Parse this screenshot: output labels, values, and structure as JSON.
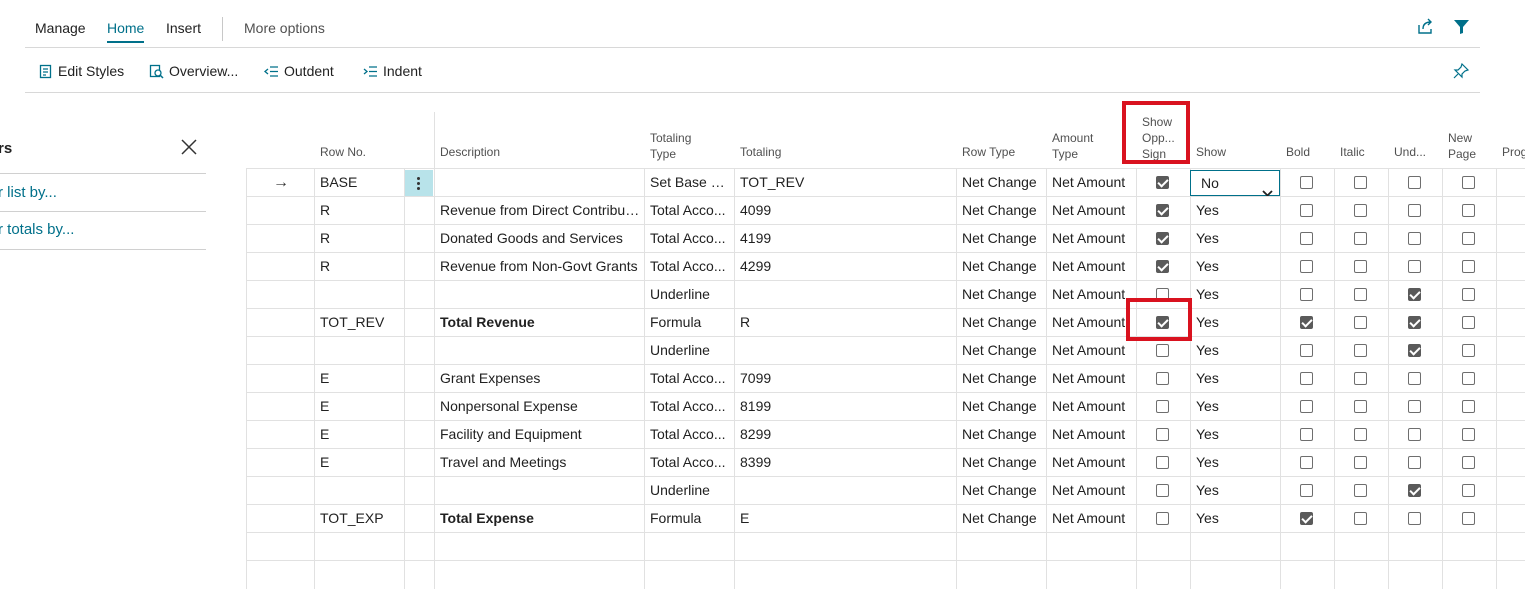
{
  "tabs": [
    {
      "label": "Manage"
    },
    {
      "label": "Home"
    },
    {
      "label": "Insert"
    },
    {
      "label": "More options"
    }
  ],
  "actions": {
    "edit_styles": "Edit Styles",
    "overview": "Overview...",
    "outdent": "Outdent",
    "indent": "Indent"
  },
  "left_pane": {
    "title": "rs",
    "link1": "r list by...",
    "link2": "r totals by..."
  },
  "columns": {
    "row_no": "Row No.",
    "description": "Description",
    "totaling_type_1": "Totaling",
    "totaling_type_2": "Type",
    "totaling": "Totaling",
    "row_type": "Row Type",
    "amount_type_1": "Amount",
    "amount_type_2": "Type",
    "show_opp_1": "Show",
    "show_opp_2": "Opp...",
    "show_opp_3": "Sign",
    "show": "Show",
    "bold": "Bold",
    "italic": "Italic",
    "underline": "Und...",
    "new_page_1": "New",
    "new_page_2": "Page",
    "prog": "Prog"
  },
  "show_select": {
    "value": "No"
  },
  "rows": [
    {
      "row_no": "BASE",
      "description": "",
      "desc_bold": false,
      "totaling_type": "Set Base Fo...",
      "totaling": "TOT_REV",
      "row_type": "Net Change",
      "amount_type": "Net Amount",
      "show_opp": true,
      "show": "No",
      "bold": false,
      "italic": false,
      "underline": false,
      "new_page": false
    },
    {
      "row_no": "R",
      "description": "Revenue from Direct Contribut...",
      "desc_bold": false,
      "totaling_type": "Total Acco...",
      "totaling": "4099",
      "row_type": "Net Change",
      "amount_type": "Net Amount",
      "show_opp": true,
      "show": "Yes",
      "bold": false,
      "italic": false,
      "underline": false,
      "new_page": false
    },
    {
      "row_no": "R",
      "description": "Donated Goods and Services",
      "desc_bold": false,
      "totaling_type": "Total Acco...",
      "totaling": "4199",
      "row_type": "Net Change",
      "amount_type": "Net Amount",
      "show_opp": true,
      "show": "Yes",
      "bold": false,
      "italic": false,
      "underline": false,
      "new_page": false
    },
    {
      "row_no": "R",
      "description": "Revenue from Non-Govt Grants",
      "desc_bold": false,
      "totaling_type": "Total Acco...",
      "totaling": "4299",
      "row_type": "Net Change",
      "amount_type": "Net Amount",
      "show_opp": true,
      "show": "Yes",
      "bold": false,
      "italic": false,
      "underline": false,
      "new_page": false
    },
    {
      "row_no": "",
      "description": "",
      "desc_bold": false,
      "totaling_type": "Underline",
      "totaling": "",
      "row_type": "Net Change",
      "amount_type": "Net Amount",
      "show_opp": false,
      "show": "Yes",
      "bold": false,
      "italic": false,
      "underline": true,
      "new_page": false
    },
    {
      "row_no": "TOT_REV",
      "description": "Total Revenue",
      "desc_bold": true,
      "totaling_type": "Formula",
      "totaling": "R",
      "row_type": "Net Change",
      "amount_type": "Net Amount",
      "show_opp": true,
      "show": "Yes",
      "bold": true,
      "italic": false,
      "underline": true,
      "new_page": false
    },
    {
      "row_no": "",
      "description": "",
      "desc_bold": false,
      "totaling_type": "Underline",
      "totaling": "",
      "row_type": "Net Change",
      "amount_type": "Net Amount",
      "show_opp": false,
      "show": "Yes",
      "bold": false,
      "italic": false,
      "underline": true,
      "new_page": false
    },
    {
      "row_no": "E",
      "description": "Grant Expenses",
      "desc_bold": false,
      "totaling_type": "Total Acco...",
      "totaling": "7099",
      "row_type": "Net Change",
      "amount_type": "Net Amount",
      "show_opp": false,
      "show": "Yes",
      "bold": false,
      "italic": false,
      "underline": false,
      "new_page": false
    },
    {
      "row_no": "E",
      "description": "Nonpersonal Expense",
      "desc_bold": false,
      "totaling_type": "Total Acco...",
      "totaling": "8199",
      "row_type": "Net Change",
      "amount_type": "Net Amount",
      "show_opp": false,
      "show": "Yes",
      "bold": false,
      "italic": false,
      "underline": false,
      "new_page": false
    },
    {
      "row_no": "E",
      "description": "Facility and Equipment",
      "desc_bold": false,
      "totaling_type": "Total Acco...",
      "totaling": "8299",
      "row_type": "Net Change",
      "amount_type": "Net Amount",
      "show_opp": false,
      "show": "Yes",
      "bold": false,
      "italic": false,
      "underline": false,
      "new_page": false
    },
    {
      "row_no": "E",
      "description": "Travel and Meetings",
      "desc_bold": false,
      "totaling_type": "Total Acco...",
      "totaling": "8399",
      "row_type": "Net Change",
      "amount_type": "Net Amount",
      "show_opp": false,
      "show": "Yes",
      "bold": false,
      "italic": false,
      "underline": false,
      "new_page": false
    },
    {
      "row_no": "",
      "description": "",
      "desc_bold": false,
      "totaling_type": "Underline",
      "totaling": "",
      "row_type": "Net Change",
      "amount_type": "Net Amount",
      "show_opp": false,
      "show": "Yes",
      "bold": false,
      "italic": false,
      "underline": true,
      "new_page": false
    },
    {
      "row_no": "TOT_EXP",
      "description": "Total Expense",
      "desc_bold": true,
      "totaling_type": "Formula",
      "totaling": "E",
      "row_type": "Net Change",
      "amount_type": "Net Amount",
      "show_opp": false,
      "show": "Yes",
      "bold": true,
      "italic": false,
      "underline": false,
      "new_page": false
    }
  ],
  "colors": {
    "accent": "#00708a",
    "highlight": "#d9121f",
    "selected_cell": "#b8e3ea"
  }
}
